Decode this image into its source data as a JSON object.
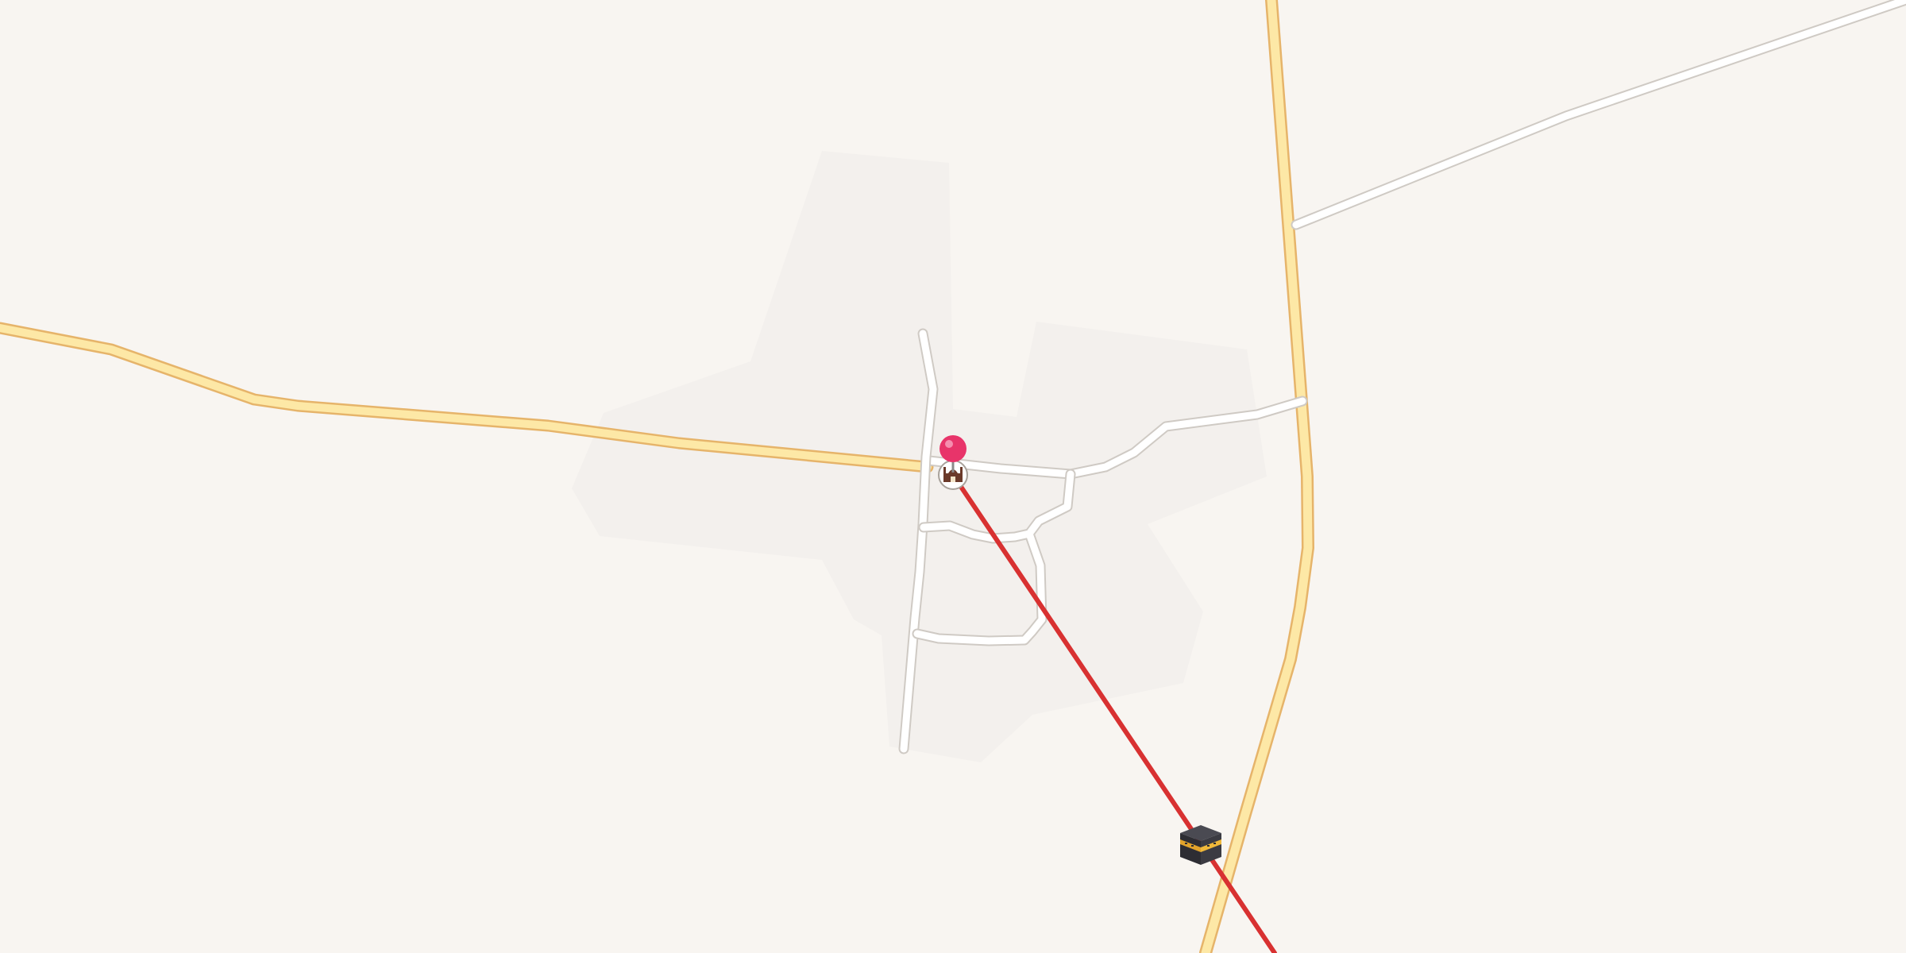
{
  "map": {
    "background_color": "#f8f5f1",
    "landuse_color": "#f3f0ed",
    "major_road_color": "#fde8a6",
    "major_road_casing_color": "#e6b46a",
    "minor_road_color": "#ffffff",
    "minor_road_casing_color": "#cfcac4",
    "direction_line_color": "#d83131"
  },
  "markers": {
    "location_pin": {
      "icon": "location-pin-icon",
      "color": "#e8346a"
    },
    "mosque": {
      "icon": "mosque-icon"
    },
    "kaaba": {
      "icon": "kaaba-icon"
    }
  }
}
